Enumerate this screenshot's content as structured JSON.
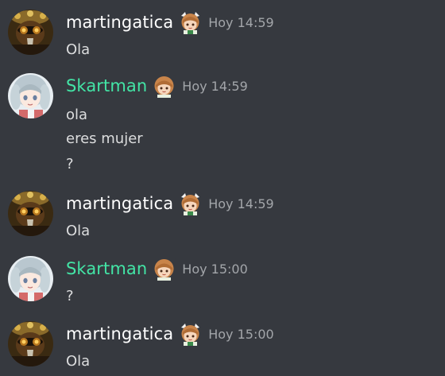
{
  "colors": {
    "background": "#36393f",
    "username_default": "#ffffff",
    "username_accent": "#43e5a6",
    "timestamp": "#a3a6aa",
    "message_text": "#dcddde"
  },
  "messages": [
    {
      "author": "martingatica",
      "timestamp": "Hoy 14:59",
      "avatar_icon": "profile-avatar-steampunk-icon",
      "badge_icon": "anime-girl-emoji-icon",
      "lines": [
        "Ola"
      ]
    },
    {
      "author": "Skartman",
      "timestamp": "Hoy 14:59",
      "avatar_icon": "profile-avatar-anime-girl-icon",
      "badge_icon": "anime-girl-emoji-icon",
      "lines": [
        "ola",
        "eres mujer",
        "?"
      ]
    },
    {
      "author": "martingatica",
      "timestamp": "Hoy 14:59",
      "avatar_icon": "profile-avatar-steampunk-icon",
      "badge_icon": "anime-girl-emoji-icon",
      "lines": [
        "Ola"
      ]
    },
    {
      "author": "Skartman",
      "timestamp": "Hoy 15:00",
      "avatar_icon": "profile-avatar-anime-girl-icon",
      "badge_icon": "anime-girl-emoji-icon",
      "lines": [
        "?"
      ]
    },
    {
      "author": "martingatica",
      "timestamp": "Hoy 15:00",
      "avatar_icon": "profile-avatar-steampunk-icon",
      "badge_icon": "anime-girl-emoji-icon",
      "lines": [
        "Ola"
      ]
    }
  ]
}
